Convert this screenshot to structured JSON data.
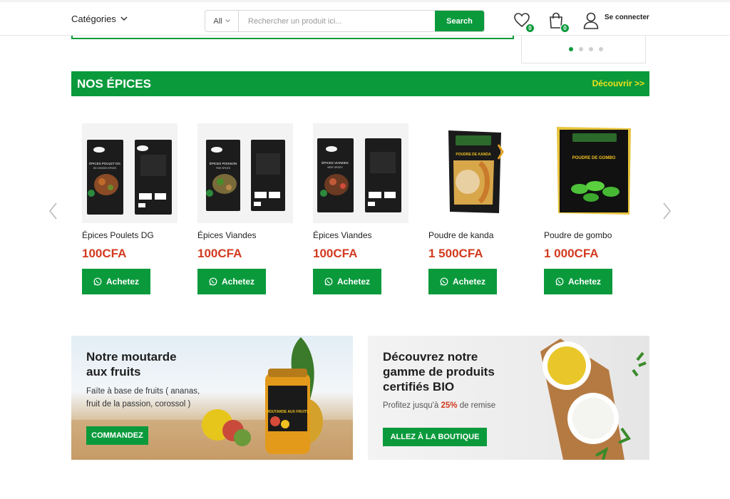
{
  "header": {
    "categories_label": "Catégories",
    "search": {
      "category": "All",
      "placeholder": "Rechercher un produit ici...",
      "button_label": "Search"
    },
    "wishlist_count": "0",
    "cart_count": "0",
    "login_label": "Se connecter"
  },
  "slider": {
    "dots": 4,
    "active_dot": 1
  },
  "section": {
    "title": "NOS ÉPICES",
    "link": "Découvrir >>"
  },
  "products": [
    {
      "name": "Épices Poulets DG",
      "price": "100CFA",
      "button": "Achetez",
      "pack_label": "ÉPICES POULET DG",
      "pack_sub": "DG CHICKEN SPICES"
    },
    {
      "name": "Épices Viandes",
      "price": "100CFA",
      "button": "Achetez",
      "pack_label": "ÉPICES POISSON",
      "pack_sub": "FISH SPICES"
    },
    {
      "name": "Épices Viandes",
      "price": "100CFA",
      "button": "Achetez",
      "pack_label": "ÉPICES VIANDES",
      "pack_sub": "BEEF SPICES"
    },
    {
      "name": "Poudre de kanda",
      "price": "1 500CFA",
      "button": "Achetez",
      "pack_label": "POUDRE DE KANDA"
    },
    {
      "name": "Poudre de gombo",
      "price": "1 000CFA",
      "button": "Achetez",
      "pack_label": "POUDRE DE GOMBO"
    }
  ],
  "promo_left": {
    "title_line1": "Notre moutarde",
    "title_line2": "aux fruits",
    "text_line1": "Faïte à base de fruits ( ananas,",
    "text_line2": "fruit de la passion, corossol )",
    "button": "COMMANDEZ",
    "jar_label": "MOUTARDE AUX FRUITS"
  },
  "promo_right": {
    "title_line1": "Découvrez notre",
    "title_line2": "gamme de produits",
    "title_line3": "certifiés BIO",
    "text_before": "Profitez jusqu'à ",
    "text_highlight": "25%",
    "text_after": " de remise",
    "button": "ALLEZ À LA BOUTIQUE"
  },
  "colors": {
    "brand_green": "#0a9a3c",
    "price_red": "#d23a1e",
    "link_yellow": "#f3e21a"
  }
}
